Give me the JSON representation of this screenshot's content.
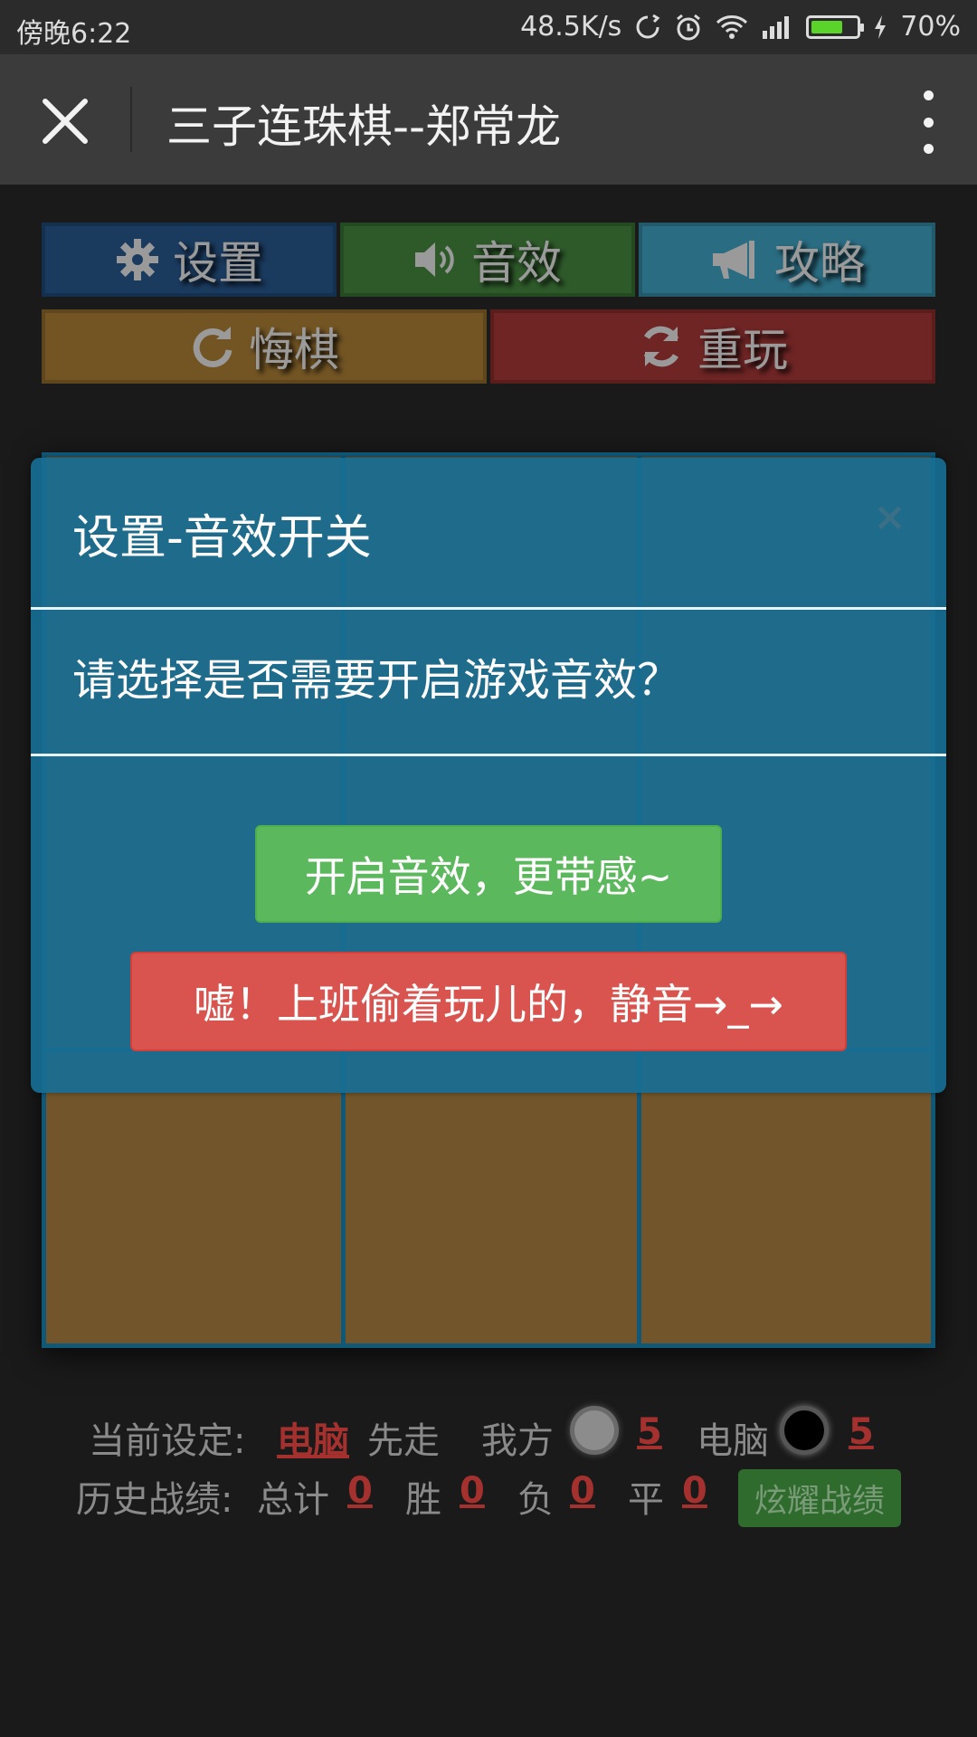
{
  "status_bar": {
    "time": "傍晚6:22",
    "net_speed": "48.5K/s",
    "battery": "70%",
    "battery_level": 0.7,
    "icons": [
      "sync-icon",
      "alarm-icon",
      "wifi-icon",
      "signal-icon",
      "battery-icon",
      "charging-icon"
    ]
  },
  "titlebar": {
    "title": "三子连珠棋--郑常龙"
  },
  "toolbar": {
    "settings_label": "设置",
    "sound_label": "音效",
    "guide_label": "攻略",
    "undo_label": "悔棋",
    "replay_label": "重玩"
  },
  "modal": {
    "title": "设置-音效开关",
    "close": "×",
    "message": "请选择是否需要开启游戏音效？",
    "enable_label": "开启音效，更带感~",
    "mute_label": "嘘！上班偷着玩儿的，静音→_→"
  },
  "stats": {
    "current_setting_label": "当前设定:",
    "first_player": "电脑",
    "first_suffix": "先走",
    "me_label": "我方",
    "me_count": "5",
    "cpu_label": "电脑",
    "cpu_count": "5",
    "history_label": "历史战绩:",
    "total_label": "总计",
    "total": "0",
    "win_label": "胜",
    "win": "0",
    "lose_label": "负",
    "lose": "0",
    "draw_label": "平",
    "draw": "0",
    "brag_label": "炫耀战绩"
  },
  "colors": {
    "modal_bg": "#176e94",
    "enable_button": "#5cb85c",
    "mute_button": "#d9534f",
    "board": "#72552a",
    "board_lines": "#105878"
  }
}
